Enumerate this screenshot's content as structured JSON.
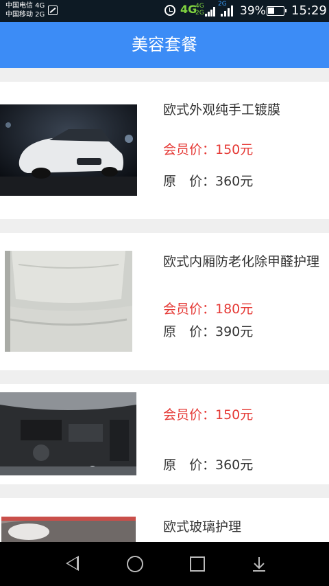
{
  "status_bar": {
    "carrier1": "中国电信 4G",
    "carrier2": "中国移动 2G",
    "net4g": "4G",
    "net_small_top": "4G",
    "net_small_bottom": "2G",
    "net2g": "2G",
    "battery_pct": "39%",
    "time": "15:29"
  },
  "header": {
    "title": "美容套餐"
  },
  "items": [
    {
      "title": "欧式外观纯手工镀膜",
      "member_price": "会员价：150元",
      "original_price": "原　价：360元"
    },
    {
      "title": "欧式内厢防老化除甲醛护理",
      "member_price": "会员价：180元",
      "original_price": "原　价：390元"
    },
    {
      "title": "",
      "member_price": "会员价：150元",
      "original_price": "原　价：360元"
    },
    {
      "title": "欧式玻璃护理"
    }
  ],
  "colors": {
    "accent": "#3c8cf6",
    "member_price": "#e53935",
    "status_bar": "#0d1a24"
  }
}
